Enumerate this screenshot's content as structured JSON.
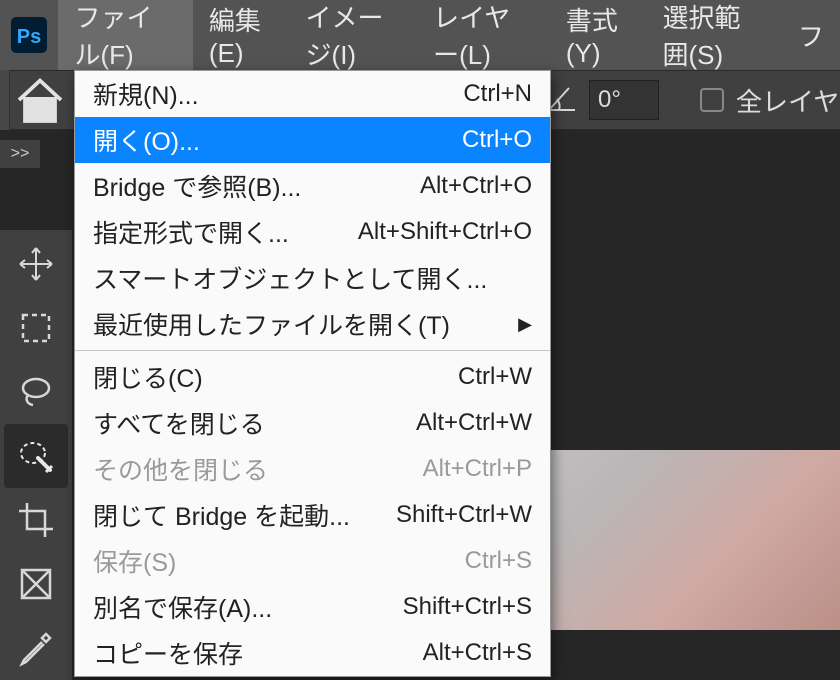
{
  "menubar": {
    "items": [
      {
        "label": "ファイル(F)",
        "active": true
      },
      {
        "label": "編集(E)"
      },
      {
        "label": "イメージ(I)"
      },
      {
        "label": "レイヤー(L)"
      },
      {
        "label": "書式(Y)"
      },
      {
        "label": "選択範囲(S)"
      },
      {
        "label": "フ"
      }
    ]
  },
  "options_bar": {
    "angle_value": "0°",
    "all_layers_label": "全レイヤ"
  },
  "collapse_label": ">>",
  "file_menu": {
    "items": [
      {
        "label": "新規(N)...",
        "shortcut": "Ctrl+N"
      },
      {
        "label": "開く(O)...",
        "shortcut": "Ctrl+O",
        "highlighted": true
      },
      {
        "label": "Bridge で参照(B)...",
        "shortcut": "Alt+Ctrl+O"
      },
      {
        "label": "指定形式で開く...",
        "shortcut": "Alt+Shift+Ctrl+O"
      },
      {
        "label": "スマートオブジェクトとして開く..."
      },
      {
        "label": "最近使用したファイルを開く(T)",
        "submenu": true
      },
      {
        "separator": true
      },
      {
        "label": "閉じる(C)",
        "shortcut": "Ctrl+W"
      },
      {
        "label": "すべてを閉じる",
        "shortcut": "Alt+Ctrl+W"
      },
      {
        "label": "その他を閉じる",
        "shortcut": "Alt+Ctrl+P",
        "disabled": true
      },
      {
        "label": "閉じて Bridge を起動...",
        "shortcut": "Shift+Ctrl+W"
      },
      {
        "label": "保存(S)",
        "shortcut": "Ctrl+S",
        "disabled": true
      },
      {
        "label": "別名で保存(A)...",
        "shortcut": "Shift+Ctrl+S"
      },
      {
        "label": "コピーを保存",
        "shortcut": "Alt+Ctrl+S"
      }
    ]
  }
}
